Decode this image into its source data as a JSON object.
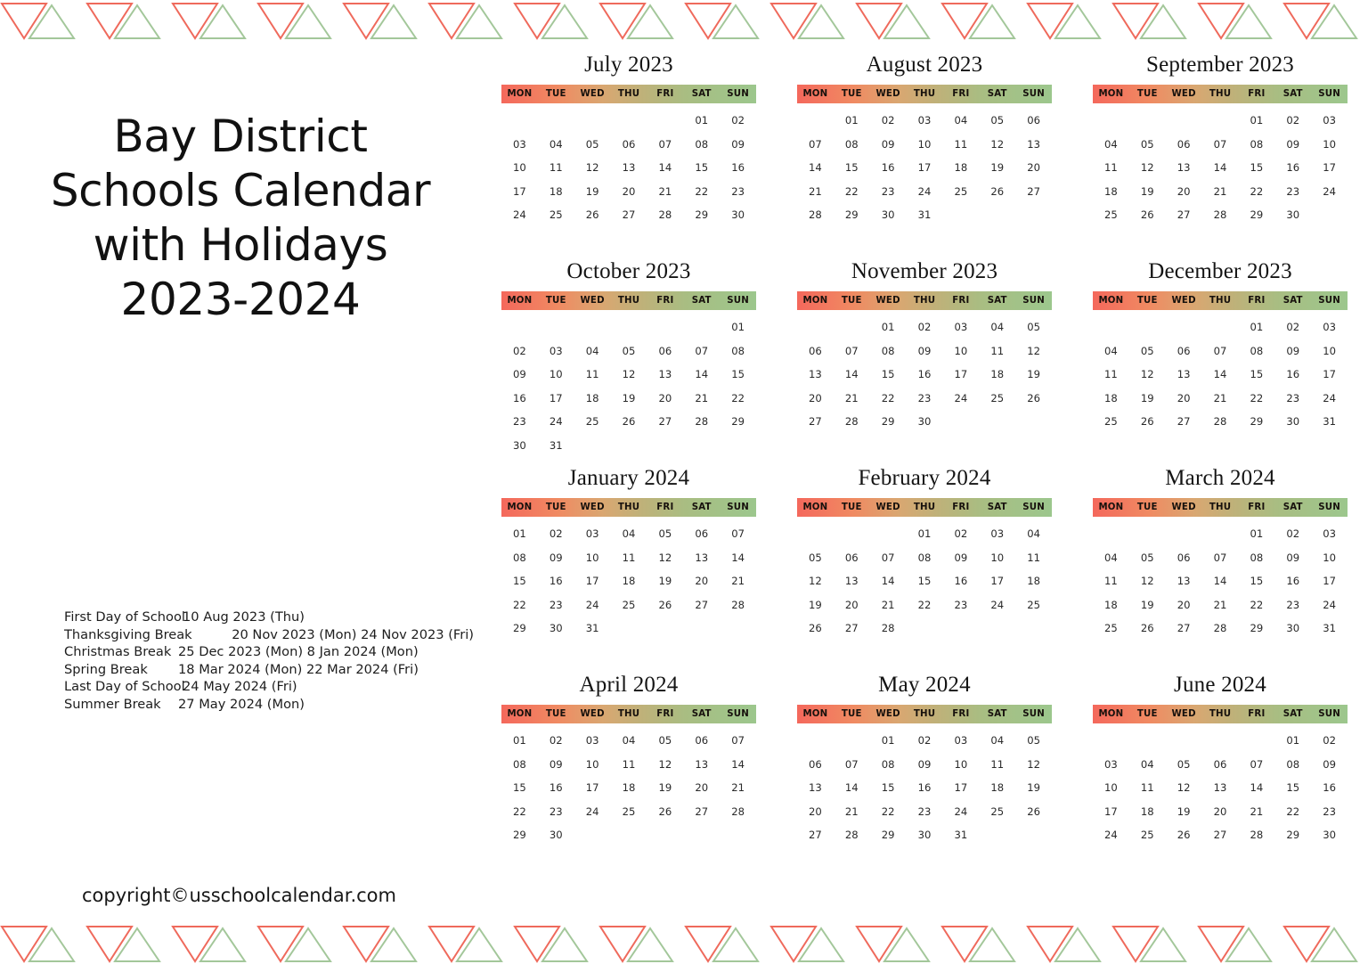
{
  "title": {
    "lines": [
      "Bay District",
      "Schools Calendar",
      "with Holidays",
      "2023-2024"
    ]
  },
  "copyright": "copyright©usschoolcalendar.com",
  "border": {
    "icon_down": "triangle-down-icon",
    "icon_up": "triangle-up-icon",
    "color_red": "#ef6a5c",
    "color_green": "#a3c79a",
    "repeat": 16
  },
  "header_gradient": {
    "from": "#f4685c",
    "to": "#9cc78d"
  },
  "weekdays": [
    "MON",
    "TUE",
    "WED",
    "THU",
    "FRI",
    "SAT",
    "SUN"
  ],
  "holidays": [
    {
      "name": "First Day of School",
      "dates": "10 Aug 2023 (Thu)"
    },
    {
      "name": "Thanksgiving Break",
      "dates": "20 Nov 2023 (Mon) 24 Nov 2023 (Fri)"
    },
    {
      "name": "Christmas Break",
      "dates": "25 Dec 2023 (Mon) 8 Jan 2024 (Mon)"
    },
    {
      "name": "Spring Break",
      "dates": "18 Mar 2024 (Mon) 22 Mar 2024 (Fri)"
    },
    {
      "name": "Last Day of School",
      "dates": "24 May 2024 (Fri)"
    },
    {
      "name": "Summer Break",
      "dates": "27 May 2024 (Mon)"
    }
  ],
  "months": [
    {
      "title": "July 2023",
      "cells": [
        "",
        "",
        "",
        "",
        "",
        "01",
        "02",
        "03",
        "04",
        "05",
        "06",
        "07",
        "08",
        "09",
        "10",
        "11",
        "12",
        "13",
        "14",
        "15",
        "16",
        "17",
        "18",
        "19",
        "20",
        "21",
        "22",
        "23",
        "24",
        "25",
        "26",
        "27",
        "28",
        "29",
        "30"
      ]
    },
    {
      "title": "August 2023",
      "cells": [
        "",
        "01",
        "02",
        "03",
        "04",
        "05",
        "06",
        "07",
        "08",
        "09",
        "10",
        "11",
        "12",
        "13",
        "14",
        "15",
        "16",
        "17",
        "18",
        "19",
        "20",
        "21",
        "22",
        "23",
        "24",
        "25",
        "26",
        "27",
        "28",
        "29",
        "30",
        "31",
        "",
        "",
        ""
      ]
    },
    {
      "title": "September 2023",
      "cells": [
        "",
        "",
        "",
        "",
        "01",
        "02",
        "03",
        "04",
        "05",
        "06",
        "07",
        "08",
        "09",
        "10",
        "11",
        "12",
        "13",
        "14",
        "15",
        "16",
        "17",
        "18",
        "19",
        "20",
        "21",
        "22",
        "23",
        "24",
        "25",
        "26",
        "27",
        "28",
        "29",
        "30",
        ""
      ]
    },
    {
      "title": "October 2023",
      "cells": [
        "",
        "",
        "",
        "",
        "",
        "",
        "01",
        "02",
        "03",
        "04",
        "05",
        "06",
        "07",
        "08",
        "09",
        "10",
        "11",
        "12",
        "13",
        "14",
        "15",
        "16",
        "17",
        "18",
        "19",
        "20",
        "21",
        "22",
        "23",
        "24",
        "25",
        "26",
        "27",
        "28",
        "29",
        "30",
        "31",
        "",
        "",
        "",
        "",
        ""
      ]
    },
    {
      "title": "November 2023",
      "cells": [
        "",
        "",
        "01",
        "02",
        "03",
        "04",
        "05",
        "06",
        "07",
        "08",
        "09",
        "10",
        "11",
        "12",
        "13",
        "14",
        "15",
        "16",
        "17",
        "18",
        "19",
        "20",
        "21",
        "22",
        "23",
        "24",
        "25",
        "26",
        "27",
        "28",
        "29",
        "30",
        "",
        "",
        ""
      ]
    },
    {
      "title": "December 2023",
      "cells": [
        "",
        "",
        "",
        "",
        "01",
        "02",
        "03",
        "04",
        "05",
        "06",
        "07",
        "08",
        "09",
        "10",
        "11",
        "12",
        "13",
        "14",
        "15",
        "16",
        "17",
        "18",
        "19",
        "20",
        "21",
        "22",
        "23",
        "24",
        "25",
        "26",
        "27",
        "28",
        "29",
        "30",
        "31"
      ]
    },
    {
      "title": "January 2024",
      "cells": [
        "01",
        "02",
        "03",
        "04",
        "05",
        "06",
        "07",
        "08",
        "09",
        "10",
        "11",
        "12",
        "13",
        "14",
        "15",
        "16",
        "17",
        "18",
        "19",
        "20",
        "21",
        "22",
        "23",
        "24",
        "25",
        "26",
        "27",
        "28",
        "29",
        "30",
        "31",
        "",
        "",
        "",
        ""
      ]
    },
    {
      "title": "February 2024",
      "cells": [
        "",
        "",
        "",
        "01",
        "02",
        "03",
        "04",
        "05",
        "06",
        "07",
        "08",
        "09",
        "10",
        "11",
        "12",
        "13",
        "14",
        "15",
        "16",
        "17",
        "18",
        "19",
        "20",
        "21",
        "22",
        "23",
        "24",
        "25",
        "26",
        "27",
        "28",
        "",
        "",
        "",
        ""
      ]
    },
    {
      "title": "March 2024",
      "cells": [
        "",
        "",
        "",
        "",
        "01",
        "02",
        "03",
        "04",
        "05",
        "06",
        "07",
        "08",
        "09",
        "10",
        "11",
        "12",
        "13",
        "14",
        "15",
        "16",
        "17",
        "18",
        "19",
        "20",
        "21",
        "22",
        "23",
        "24",
        "25",
        "26",
        "27",
        "28",
        "29",
        "30",
        "31"
      ]
    },
    {
      "title": "April 2024",
      "cells": [
        "01",
        "02",
        "03",
        "04",
        "05",
        "06",
        "07",
        "08",
        "09",
        "10",
        "11",
        "12",
        "13",
        "14",
        "15",
        "16",
        "17",
        "18",
        "19",
        "20",
        "21",
        "22",
        "23",
        "24",
        "25",
        "26",
        "27",
        "28",
        "29",
        "30",
        "",
        "",
        "",
        "",
        ""
      ]
    },
    {
      "title": "May 2024",
      "cells": [
        "",
        "",
        "01",
        "02",
        "03",
        "04",
        "05",
        "06",
        "07",
        "08",
        "09",
        "10",
        "11",
        "12",
        "13",
        "14",
        "15",
        "16",
        "17",
        "18",
        "19",
        "20",
        "21",
        "22",
        "23",
        "24",
        "25",
        "26",
        "27",
        "28",
        "29",
        "30",
        "31",
        "",
        ""
      ]
    },
    {
      "title": "June 2024",
      "cells": [
        "",
        "",
        "",
        "",
        "",
        "01",
        "02",
        "03",
        "04",
        "05",
        "06",
        "07",
        "08",
        "09",
        "10",
        "11",
        "12",
        "13",
        "14",
        "15",
        "16",
        "17",
        "18",
        "19",
        "20",
        "21",
        "22",
        "23",
        "24",
        "25",
        "26",
        "27",
        "28",
        "29",
        "30"
      ]
    }
  ]
}
